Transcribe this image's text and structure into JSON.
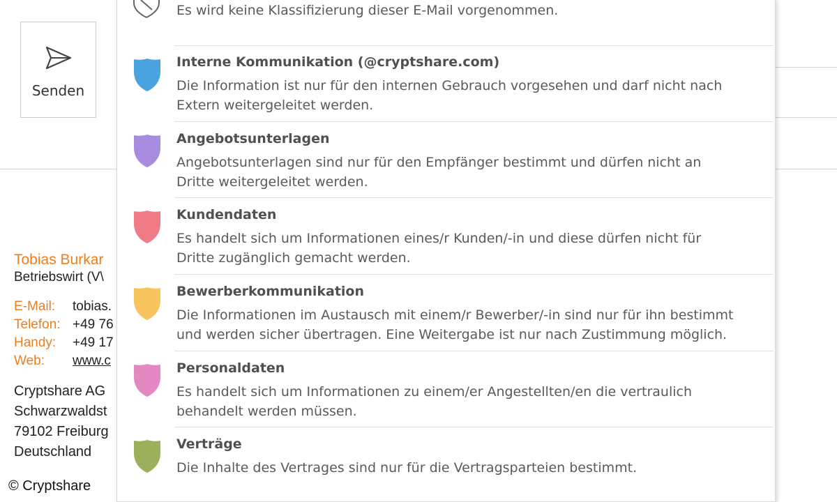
{
  "compose": {
    "send_label": "Senden"
  },
  "signature": {
    "name": "Tobias Burkar",
    "title": "Betriebswirt (V\\",
    "contacts": [
      {
        "key": "E-Mail:",
        "value": "tobias.",
        "link": false
      },
      {
        "key": "Telefon:",
        "value": "+49 76",
        "link": false
      },
      {
        "key": "Handy:",
        "value": "+49 17",
        "link": false
      },
      {
        "key": "Web:",
        "value": "www.c",
        "link": true
      }
    ],
    "address": [
      "Cryptshare AG",
      "Schwarzwaldst",
      "79102 Freiburg",
      "Deutschland"
    ]
  },
  "copyright": "© Cryptshare",
  "classification_menu": {
    "none_item": {
      "description": "Es wird keine Klassifizierung dieser E-Mail vorgenommen."
    },
    "items": [
      {
        "title": "Interne Kommunikation (@cryptshare.com)",
        "lines": [
          "Die Information ist nur für den internen Gebrauch vorgesehen und darf nicht nach",
          "Extern weitergeleitet werden."
        ],
        "color": "#4aa3df"
      },
      {
        "title": "Angebotsunterlagen",
        "lines": [
          "Angebotsunterlagen sind nur für den Empfänger bestimmt und dürfen nicht an",
          "Dritte weitergeleitet werden."
        ],
        "color": "#a78ce0"
      },
      {
        "title": "Kundendaten",
        "lines": [
          "Es handelt sich um Informationen eines/r Kunden/-in und diese dürfen nicht für",
          "Dritte zugänglich gemacht werden."
        ],
        "color": "#ef7b86"
      },
      {
        "title": "Bewerberkommunikation",
        "lines": [
          "Die Informationen im Austausch mit einem/r Bewerber/-in sind nur für ihn bestimmt",
          "und werden sicher übertragen. Eine Weitergabe ist nur nach Zustimmung möglich."
        ],
        "color": "#f7c460"
      },
      {
        "title": "Personaldaten",
        "lines": [
          "Es handelt sich um Informationen zu einem/er Angestellten/en die vertraulich",
          "behandelt werden müssen."
        ],
        "color": "#e388c0"
      },
      {
        "title": "Verträge",
        "lines": [
          "Die Inhalte des Vertrages sind nur für die Vertragsparteien bestimmt."
        ],
        "color": "#9bb05b"
      }
    ]
  }
}
